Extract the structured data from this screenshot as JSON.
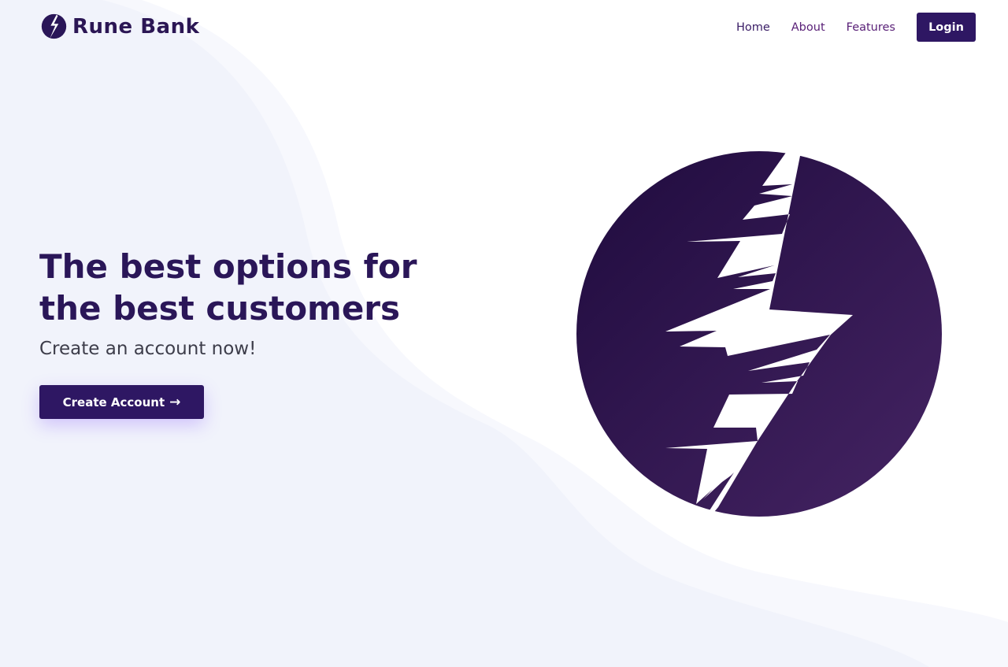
{
  "brand": {
    "name": "Rune Bank",
    "logo_icon": "lightning-bolt-circle-icon"
  },
  "nav": {
    "links": [
      "Home",
      "About",
      "Features"
    ],
    "login_label": "Login"
  },
  "hero": {
    "title": "The best options for the best customers",
    "subtitle": "Create an account now!",
    "cta_label": "Create Account",
    "cta_icon": "arrow-right-icon",
    "art_icon": "lightning-bolt-circle-icon"
  },
  "colors": {
    "primary": "#2e1763",
    "heading": "#2a1658",
    "gradient_start": "#1f0b3e",
    "gradient_end": "#452463",
    "background_wave": "#f1f3fb"
  }
}
